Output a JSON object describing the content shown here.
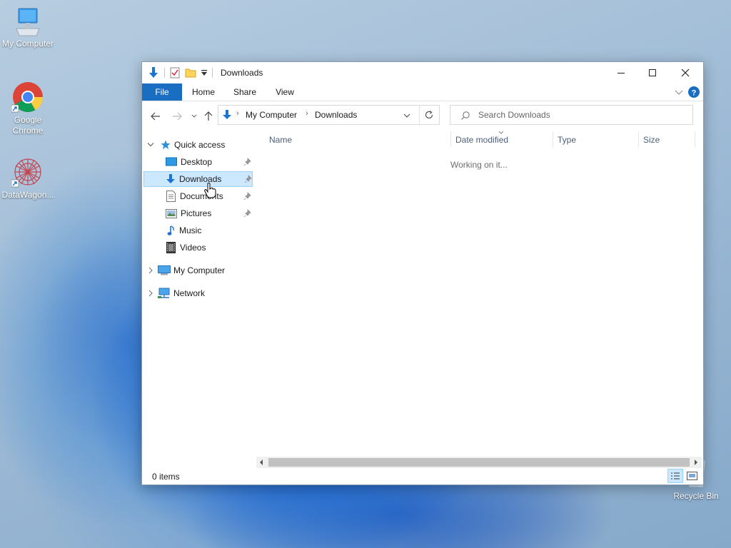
{
  "desktop": {
    "icons": [
      {
        "label": "My Computer",
        "icon": "computer-icon"
      },
      {
        "label": "Google Chrome",
        "icon": "chrome-icon"
      },
      {
        "label": "DataWagon...",
        "icon": "datawagon-icon"
      },
      {
        "label": "Recycle Bin",
        "icon": "recycle-bin-icon"
      }
    ]
  },
  "window": {
    "title": "Downloads",
    "ribbon_tabs": [
      "File",
      "Home",
      "Share",
      "View"
    ],
    "address": {
      "root": "My Computer",
      "current": "Downloads"
    },
    "search": {
      "placeholder": "Search Downloads"
    },
    "nav": {
      "quick_access": "Quick access",
      "quick_items": [
        "Desktop",
        "Downloads",
        "Documents",
        "Pictures",
        "Music",
        "Videos"
      ],
      "this_pc": "My Computer",
      "network": "Network"
    },
    "columns": [
      "Name",
      "Date modified",
      "Type",
      "Size"
    ],
    "working_text": "Working on it...",
    "status": "0 items"
  }
}
